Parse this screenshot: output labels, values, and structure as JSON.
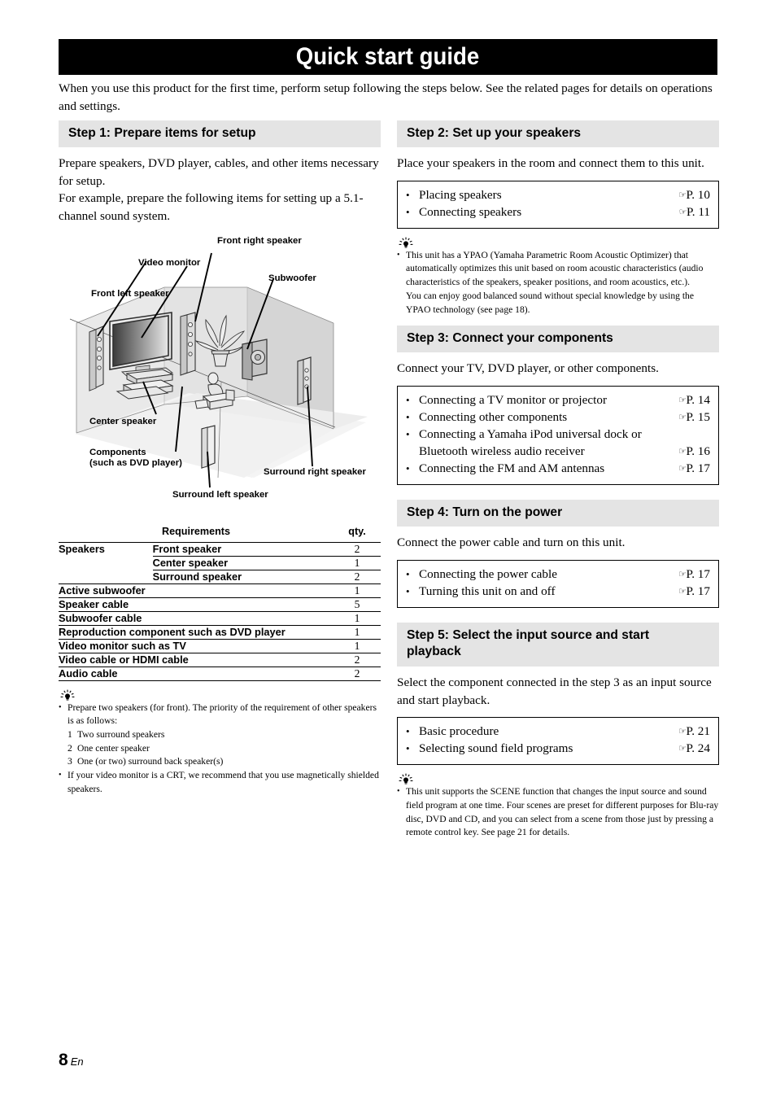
{
  "page": {
    "title": "Quick start guide",
    "intro": "When you use this product for the first time, perform setup following the steps below. See the related pages for details on operations and settings.",
    "number": "8",
    "language_mark": "En"
  },
  "step1": {
    "header": "Step 1: Prepare items for setup",
    "body_line1": "Prepare speakers, DVD player, cables, and other items necessary for setup.",
    "body_line2": "For example, prepare the following items for setting up a 5.1-channel sound system.",
    "diagram": {
      "labels": {
        "front_right_speaker": "Front right speaker",
        "video_monitor": "Video monitor",
        "subwoofer": "Subwoofer",
        "front_left_speaker": "Front left speaker",
        "center_speaker": "Center speaker",
        "components_line1": "Components",
        "components_line2": "(such as DVD player)",
        "surround_right_speaker": "Surround right speaker",
        "surround_left_speaker": "Surround left speaker"
      }
    },
    "table": {
      "head_requirements": "Requirements",
      "head_qty": "qty.",
      "rows": [
        {
          "group": "Speakers",
          "item": "Front speaker",
          "qty": "2"
        },
        {
          "group": "",
          "item": "Center speaker",
          "qty": "1"
        },
        {
          "group": "",
          "item": "Surround speaker",
          "qty": "2"
        },
        {
          "group": "Active subwoofer",
          "item": "",
          "qty": "1"
        },
        {
          "group": "Speaker cable",
          "item": "",
          "qty": "5"
        },
        {
          "group": "Subwoofer cable",
          "item": "",
          "qty": "1"
        },
        {
          "group": "Reproduction component such as DVD player",
          "item": "",
          "qty": "1"
        },
        {
          "group": "Video monitor such as TV",
          "item": "",
          "qty": "1"
        },
        {
          "group": "Video cable or HDMI cable",
          "item": "",
          "qty": "2"
        },
        {
          "group": "Audio cable",
          "item": "",
          "qty": "2"
        }
      ]
    },
    "tip": {
      "item1": "Prepare two speakers (for front). The priority of the requirement of other speakers is as follows:",
      "sub1_num": "1",
      "sub1_text": "Two surround speakers",
      "sub2_num": "2",
      "sub2_text": "One center speaker",
      "sub3_num": "3",
      "sub3_text": "One (or two) surround back speaker(s)",
      "item2": "If your video monitor is a CRT, we recommend that you use magnetically shielded speakers."
    }
  },
  "step2": {
    "header": "Step 2: Set up your speakers",
    "body": "Place your speakers in the room and connect them to this unit.",
    "refs": [
      {
        "label": "Placing speakers",
        "page": "P. 10"
      },
      {
        "label": "Connecting speakers",
        "page": "P. 11"
      }
    ],
    "tip": "This unit has a YPAO (Yamaha Parametric Room Acoustic Optimizer) that automatically optimizes this unit based on room acoustic characteristics (audio characteristics of the speakers, speaker positions, and room acoustics, etc.).",
    "tip_cont": "You can enjoy good balanced sound without special knowledge by using the YPAO technology (see page 18)."
  },
  "step3": {
    "header": "Step 3: Connect your components",
    "body": "Connect your TV, DVD player, or other components.",
    "refs": [
      {
        "label": "Connecting a TV monitor or projector",
        "page": "P. 14"
      },
      {
        "label": "Connecting other components",
        "page": "P. 15"
      },
      {
        "label": "Connecting a Yamaha iPod universal dock or Bluetooth wireless audio receiver",
        "page": "P. 16"
      },
      {
        "label": "Connecting the FM and AM antennas",
        "page": "P. 17"
      }
    ]
  },
  "step4": {
    "header": "Step 4: Turn on the power",
    "body": "Connect the power cable and turn on this unit.",
    "refs": [
      {
        "label": "Connecting the power cable",
        "page": "P. 17"
      },
      {
        "label": "Turning this unit on and off",
        "page": "P. 17"
      }
    ]
  },
  "step5": {
    "header_line1": "Step 5: Select the input source and start",
    "header_line2": "playback",
    "body": "Select the component connected in the step 3 as an input source and start playback.",
    "refs": [
      {
        "label": "Basic procedure",
        "page": "P. 21"
      },
      {
        "label": "Selecting sound field programs",
        "page": "P. 24"
      }
    ],
    "tip": "This unit supports the SCENE function that changes the input source and sound field program at one time. Four scenes are preset for different purposes for Blu-ray disc, DVD and CD, and you can select from a scene from those just by pressing a remote control key. See page 21 for details."
  },
  "glyphs": {
    "hand": "☞",
    "bullet": "•"
  }
}
